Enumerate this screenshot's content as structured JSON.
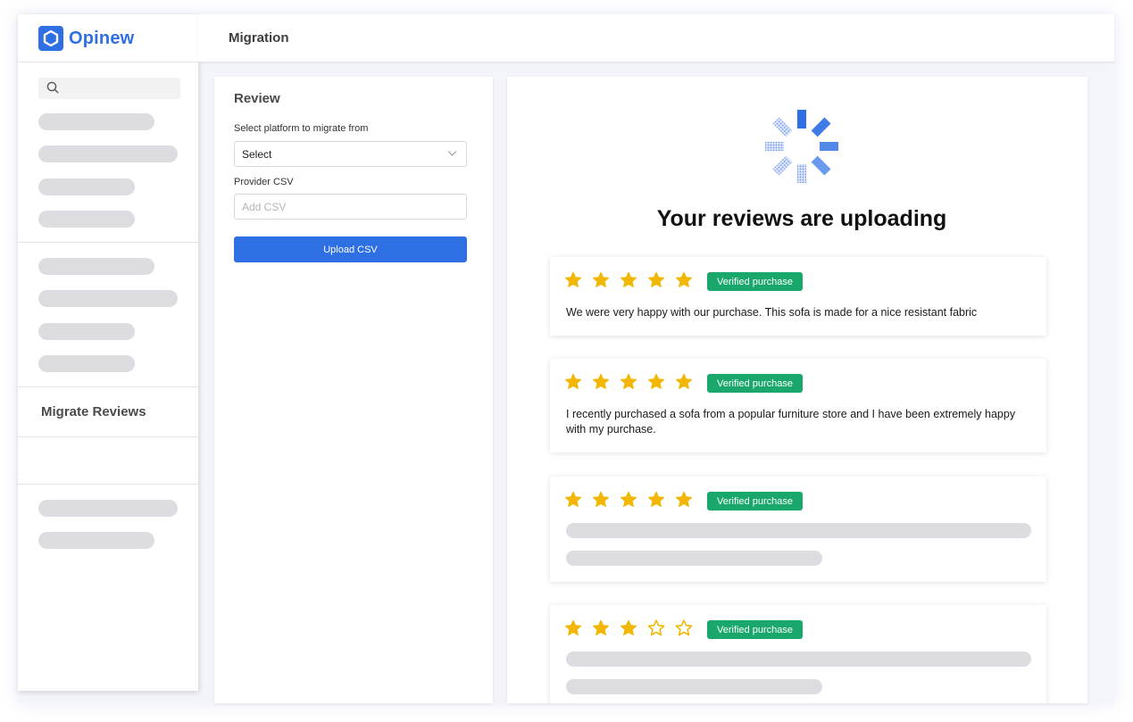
{
  "brand": {
    "name": "Opinew",
    "color": "#2f6fe4"
  },
  "header": {
    "title": "Migration"
  },
  "sidebar": {
    "search_icon": "search-icon",
    "active_heading": "Migrate Reviews"
  },
  "form": {
    "title": "Review",
    "platform_label": "Select platform to migrate from",
    "platform_value": "Select",
    "csv_label": "Provider CSV",
    "csv_placeholder": "Add CSV",
    "upload_button": "Upload CSV"
  },
  "main": {
    "title": "Your reviews are uploading",
    "spinner_icon": "loading-spinner-icon",
    "reviews": [
      {
        "rating": 5,
        "badge": "Verified purchase",
        "text": "We were very happy with our purchase. This sofa is made for a nice resistant fabric"
      },
      {
        "rating": 5,
        "badge": "Verified purchase",
        "text": "I recently purchased a sofa from a popular furniture store and I have been extremely happy with my purchase."
      },
      {
        "rating": 5,
        "badge": "Verified purchase",
        "text": ""
      },
      {
        "rating": 3,
        "badge": "Verified purchase",
        "text": ""
      }
    ]
  },
  "colors": {
    "accent": "#2f6fe4",
    "badge": "#1aa76b",
    "star": "#f2b705",
    "skeleton": "#dcdce1"
  }
}
